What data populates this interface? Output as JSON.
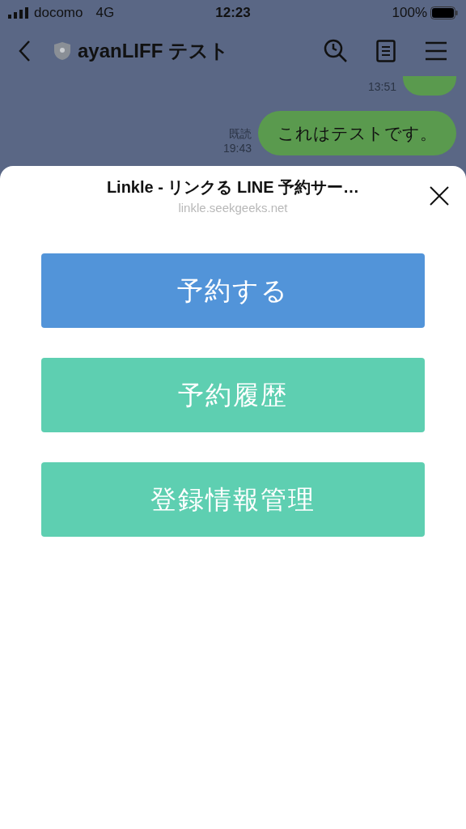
{
  "status_bar": {
    "carrier": "docomo",
    "network": "4G",
    "time": "12:23",
    "battery": "100%"
  },
  "header": {
    "title": "ayanLIFF テスト"
  },
  "messages": [
    {
      "kind": "cut",
      "time": "13:51"
    },
    {
      "kind": "full",
      "text": "これはテストです。",
      "read": "既読",
      "time": "19:43"
    }
  ],
  "sheet": {
    "title": "Linkle - リンクる LINE 予約サー…",
    "url": "linkle.seekgeeks.net"
  },
  "buttons": [
    {
      "label": "予約する",
      "color": "#5294d9"
    },
    {
      "label": "予約履歴",
      "color": "#5ecfb1"
    },
    {
      "label": "登録情報管理",
      "color": "#5ecfb1"
    }
  ]
}
